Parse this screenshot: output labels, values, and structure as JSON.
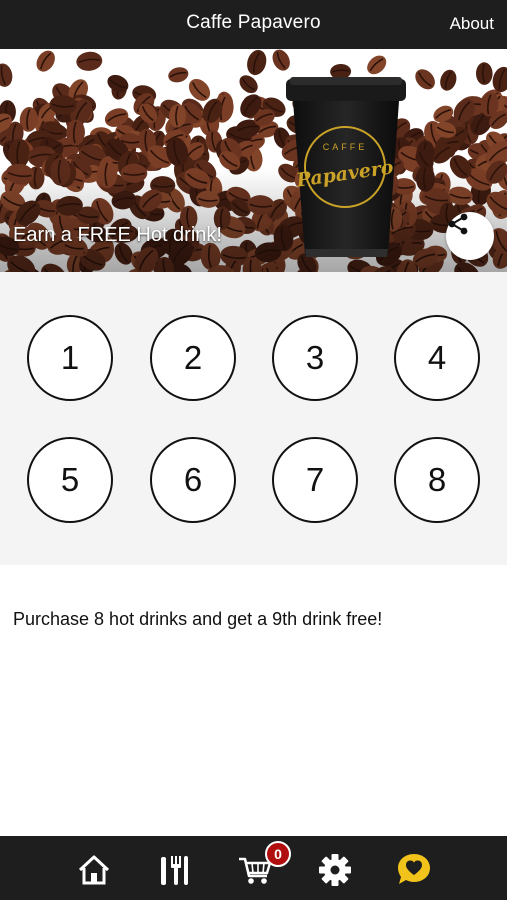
{
  "header": {
    "title": "Caffe Papavero",
    "about_label": "About"
  },
  "hero": {
    "caption": "Earn a FREE Hot drink!",
    "cup_brand_small": "CAFFE",
    "cup_brand_large": "Papavero",
    "share_icon": "share-icon"
  },
  "stamps": [
    "1",
    "2",
    "3",
    "4",
    "5",
    "6",
    "7",
    "8"
  ],
  "description": "Purchase 8 hot drinks and get a 9th drink free!",
  "bottom_nav": {
    "items": [
      {
        "name": "home",
        "icon": "home-icon"
      },
      {
        "name": "menu",
        "icon": "utensils-icon"
      },
      {
        "name": "cart",
        "icon": "cart-icon",
        "badge": "0"
      },
      {
        "name": "settings",
        "icon": "gear-icon"
      },
      {
        "name": "loyalty",
        "icon": "heart-chat-icon"
      }
    ]
  },
  "colors": {
    "bar_bg": "#1f1e1e",
    "badge_red": "#b00e0e",
    "loyalty_yellow": "#f2c31a",
    "cup_gold": "#c9a227"
  }
}
